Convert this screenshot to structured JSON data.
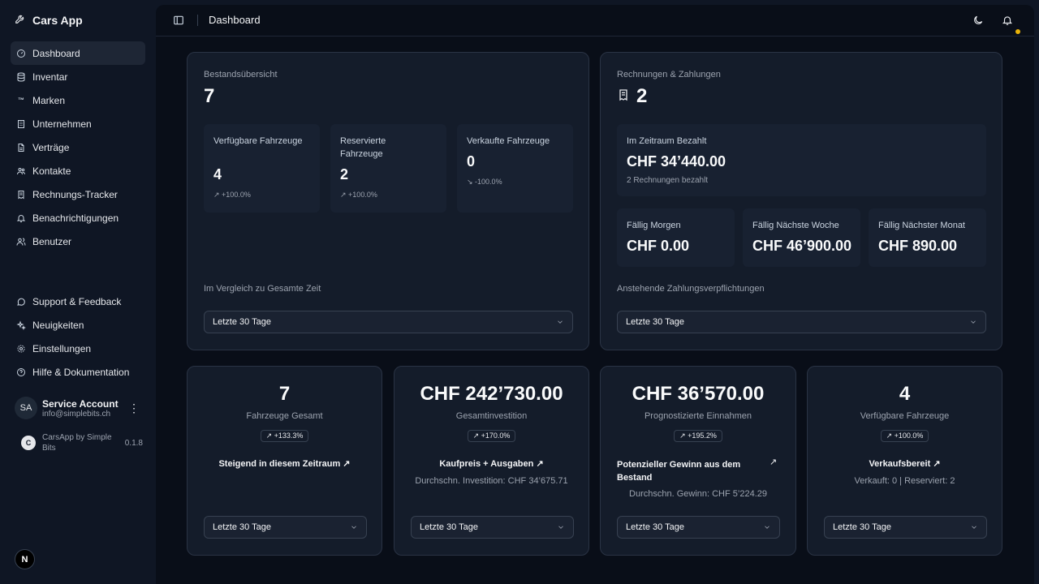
{
  "app": {
    "name": "Cars App"
  },
  "sidebar": {
    "items": [
      {
        "label": "Dashboard",
        "icon": "dashboard-icon"
      },
      {
        "label": "Inventar",
        "icon": "database-icon"
      },
      {
        "label": "Marken",
        "icon": "trademark-icon"
      },
      {
        "label": "Unternehmen",
        "icon": "building-icon"
      },
      {
        "label": "Verträge",
        "icon": "document-icon"
      },
      {
        "label": "Kontakte",
        "icon": "contacts-icon"
      },
      {
        "label": "Rechnungs-Tracker",
        "icon": "receipt-icon"
      },
      {
        "label": "Benachrichtigungen",
        "icon": "bell-icon"
      },
      {
        "label": "Benutzer",
        "icon": "users-icon"
      }
    ],
    "secondary": [
      {
        "label": "Support & Feedback",
        "icon": "chat-icon"
      },
      {
        "label": "Neuigkeiten",
        "icon": "sparkles-icon"
      },
      {
        "label": "Einstellungen",
        "icon": "gear-icon"
      },
      {
        "label": "Hilfe & Dokumentation",
        "icon": "help-icon"
      }
    ],
    "account": {
      "initials": "SA",
      "name": "Service Account",
      "email": "info@simplebits.ch"
    },
    "product": {
      "name": "CarsApp by Simple Bits",
      "version": "0.1.8",
      "logo_text": "C"
    },
    "n_logo": "N"
  },
  "header": {
    "title": "Dashboard"
  },
  "inventory": {
    "title": "Bestandsübersicht",
    "total": "7",
    "stats": [
      {
        "label": "Verfügbare Fahrzeuge",
        "value": "4",
        "trend": "+100.0%"
      },
      {
        "label": "Reservierte Fahrzeuge",
        "value": "2",
        "trend": "+100.0%"
      },
      {
        "label": "Verkaufte Fahrzeuge",
        "value": "0",
        "trend": "-100.0%"
      }
    ],
    "compare": "Im Vergleich zu Gesamte Zeit",
    "select": "Letzte 30 Tage"
  },
  "invoices": {
    "title": "Rechnungen & Zahlungen",
    "count": "2",
    "paid_label": "Im Zeitraum Bezahlt",
    "paid_value": "CHF 34’440.00",
    "paid_sub": "2 Rechnungen bezahlt",
    "due": [
      {
        "label": "Fällig Morgen",
        "value": "CHF 0.00"
      },
      {
        "label": "Fällig Nächste Woche",
        "value": "CHF 46’900.00"
      },
      {
        "label": "Fällig Nächster Monat",
        "value": "CHF 890.00"
      }
    ],
    "pending": "Anstehende Zahlungsverpflichtungen",
    "select": "Letzte 30 Tage"
  },
  "kpis": [
    {
      "value": "7",
      "label": "Fahrzeuge Gesamt",
      "badge": "+133.3%",
      "headline": "Steigend in diesem Zeitraum",
      "sub": "",
      "select": "Letzte 30 Tage"
    },
    {
      "value": "CHF 242’730.00",
      "label": "Gesamtinvestition",
      "badge": "+170.0%",
      "headline": "Kaufpreis + Ausgaben",
      "sub": "Durchschn. Investition: CHF 34’675.71",
      "select": "Letzte 30 Tage"
    },
    {
      "value": "CHF 36’570.00",
      "label": "Prognostizierte Einnahmen",
      "badge": "+195.2%",
      "headline": "Potenzieller Gewinn aus dem Bestand",
      "sub": "Durchschn. Gewinn: CHF 5’224.29",
      "select": "Letzte 30 Tage"
    },
    {
      "value": "4",
      "label": "Verfügbare Fahrzeuge",
      "badge": "+100.0%",
      "headline": "Verkaufsbereit",
      "sub": "Verkauft: 0 | Reserviert: 2",
      "select": "Letzte 30 Tage"
    }
  ],
  "colors": {
    "accent_dot": "#eab308",
    "bg": "#090e18",
    "card": "#141c2a"
  }
}
